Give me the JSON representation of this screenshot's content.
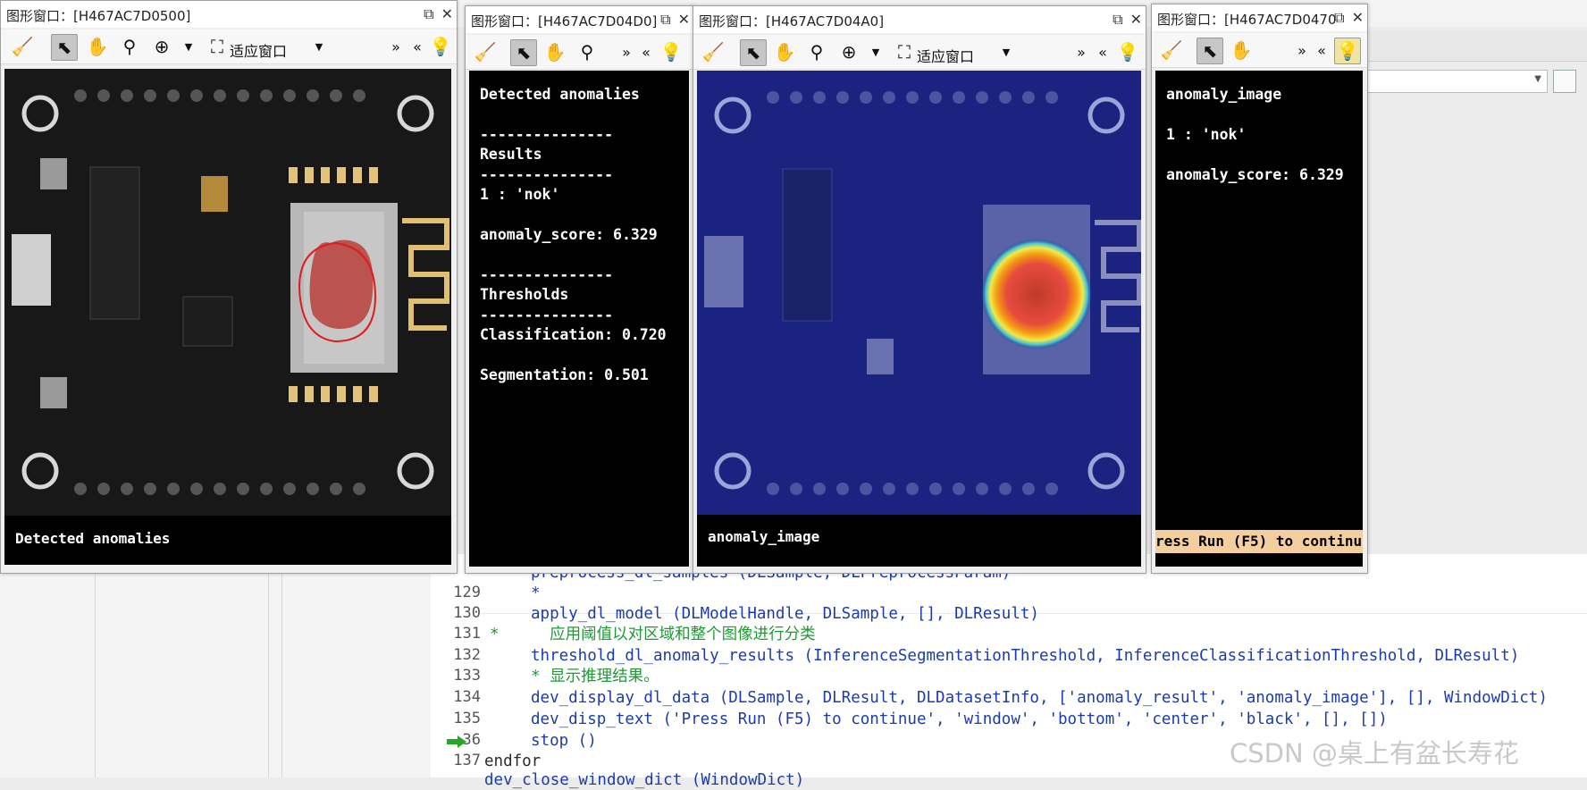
{
  "windows": [
    {
      "title": "图形窗口：[H467AC7D0500]",
      "fit_label": "适应窗口",
      "caption": "Detected anomalies"
    },
    {
      "title": "图形窗口：[H467AC7D04D0]"
    },
    {
      "title": "图形窗口：[H467AC7D04A0]",
      "fit_label": "适应窗口",
      "caption": "anomaly_image"
    },
    {
      "title": "图形窗口：[H467AC7D0470"
    }
  ],
  "results_window": {
    "heading": "Detected anomalies",
    "sep1": "---------------",
    "results_label": "Results",
    "sep2": "---------------",
    "class_line": "1 : 'nok'",
    "score_line": "anomaly_score: 6.329",
    "sep3": "---------------",
    "thresholds_label": "Thresholds",
    "sep4": "---------------",
    "classification_line": "Classification: 0.720",
    "segmentation_line": "Segmentation: 0.501"
  },
  "summary_window": {
    "line1": "anomaly_image",
    "line2": "1 : 'nok'",
    "line3": "anomaly_score: 6.329",
    "press_text": "ress Run (F5) to continu"
  },
  "code": {
    "partial_top": "preprocess_dl_samples (DLSample, DLPreprocessParam)",
    "lines": [
      {
        "num": "129",
        "text": "*"
      },
      {
        "num": "130",
        "text": "apply_dl_model (DLModelHandle, DLSample, [], DLResult)"
      },
      {
        "num": "131",
        "text": "  应用阈值以对区域和整个图像进行分类"
      },
      {
        "num": "132",
        "text": "threshold_dl_anomaly_results (InferenceSegmentationThreshold, InferenceClassificationThreshold, DLResult)"
      },
      {
        "num": "133",
        "text": "* 显示推理结果。"
      },
      {
        "num": "134",
        "text": "dev_display_dl_data (DLSample, DLResult, DLDatasetInfo, ['anomaly_result', 'anomaly_image'], [], WindowDict)"
      },
      {
        "num": "135",
        "text": "dev_disp_text ('Press Run (F5) to continue', 'window', 'bottom', 'center', 'black', [], [])"
      },
      {
        "num": "36",
        "text": "stop ()"
      },
      {
        "num": "137",
        "text": "endfor"
      }
    ],
    "partial_bottom": "dev_close_window_dict (WindowDict)"
  },
  "watermark": "CSDN @桌上有盆长寿花",
  "colors": {
    "operator": "#1a3cb0",
    "comment": "#1e9a35",
    "anomaly_contour": "#e11b1b"
  }
}
